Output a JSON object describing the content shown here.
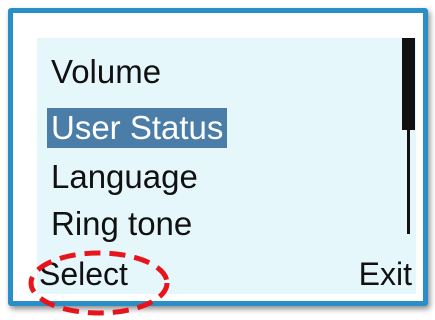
{
  "menu": {
    "items": [
      {
        "label": "Volume",
        "selected": false
      },
      {
        "label": "User Status",
        "selected": true
      },
      {
        "label": "Language",
        "selected": false
      },
      {
        "label": "Ring  tone",
        "selected": false
      }
    ]
  },
  "softkeys": {
    "left_label": "Select",
    "right_label": "Exit"
  },
  "scrollbar": {
    "position_fraction": 0.0,
    "visible_fraction": 0.47
  },
  "colors": {
    "frame_border": "#2a8fc9",
    "screen_background": "#e6f7fc",
    "selection_background": "#4a7ea8",
    "annotation": "#e8141c"
  }
}
